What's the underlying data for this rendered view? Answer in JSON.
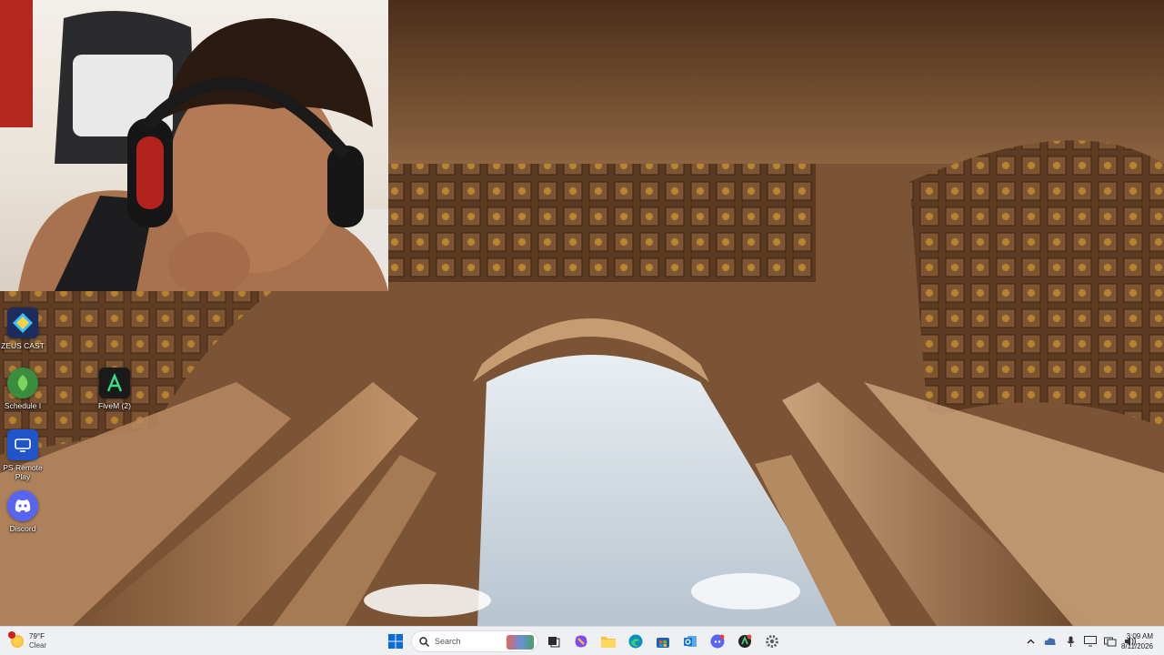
{
  "desktop": {
    "icons": [
      {
        "label": "ZEUS CAST",
        "icon": "zeus-cast-icon",
        "color": "#1c2c5c"
      },
      {
        "label": "Schedule I",
        "icon": "schedule-one-icon",
        "color": "#3a8c3f"
      },
      {
        "label": "FiveM (2)",
        "icon": "fivem-icon",
        "color": "#1a1a1a"
      },
      {
        "label": "PS Remote Play",
        "icon": "ps-remote-play-icon",
        "color": "#1f55c8"
      },
      {
        "label": "Discord",
        "icon": "discord-icon",
        "color": "#5865f2"
      }
    ]
  },
  "taskbar": {
    "weather": {
      "temp": "79°F",
      "condition": "Clear",
      "icon": "sun-icon"
    },
    "search_placeholder": "Search",
    "pinned": [
      {
        "name": "start-button",
        "icon": "windows-icon",
        "color": "#0a6cd6"
      },
      {
        "name": "task-view-button",
        "icon": "task-view-icon",
        "color": "#2b2b2b"
      },
      {
        "name": "copilot-button",
        "icon": "copilot-icon",
        "color": "#7c4dff"
      },
      {
        "name": "file-explorer-button",
        "icon": "folder-icon",
        "color": "#f5c23a"
      },
      {
        "name": "edge-button",
        "icon": "edge-icon",
        "color": "#0f8fbf"
      },
      {
        "name": "store-button",
        "icon": "store-icon",
        "color": "#1b5fbf"
      },
      {
        "name": "outlook-button",
        "icon": "outlook-icon",
        "color": "#1a73d9"
      },
      {
        "name": "discord-taskbar-button",
        "icon": "discord-icon",
        "color": "#5865f2"
      },
      {
        "name": "app-button",
        "icon": "app-icon",
        "color": "#222222"
      },
      {
        "name": "settings-button",
        "icon": "gear-icon",
        "color": "#5b5f66"
      }
    ],
    "clock": {
      "time": "3:09 AM",
      "date": "8/11/2026"
    }
  },
  "colors": {
    "taskbar_bg": "#eef0f3",
    "accent": "#0a6cd6"
  }
}
